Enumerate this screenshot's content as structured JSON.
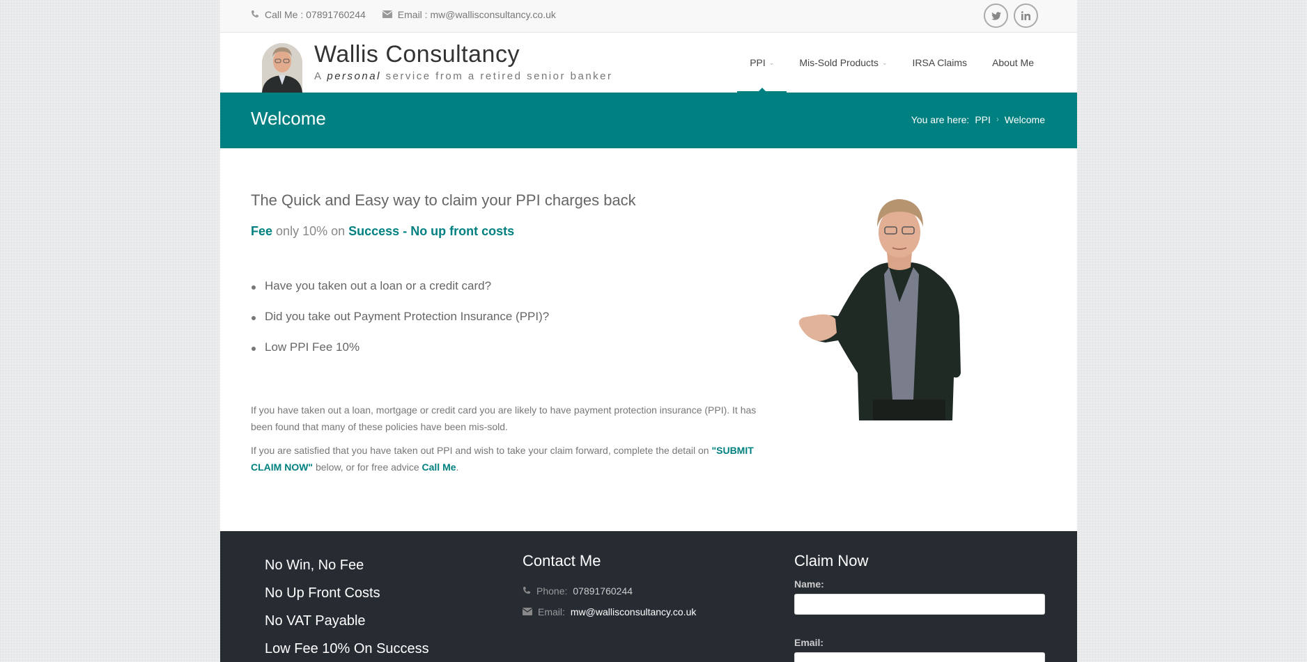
{
  "topbar": {
    "phone": "Call Me : 07891760244",
    "email": "Email : mw@wallisconsultancy.co.uk",
    "social": [
      "twitter-icon",
      "linkedin-icon"
    ]
  },
  "header": {
    "title": "Wallis Consultancy",
    "tagline_a": "A",
    "tagline_em": "personal",
    "tagline_rest": "service from a retired senior banker"
  },
  "nav": {
    "items": [
      {
        "label": "PPI",
        "dropdown": true,
        "active": true
      },
      {
        "label": "Mis-Sold Products",
        "dropdown": true
      },
      {
        "label": "IRSA Claims"
      },
      {
        "label": "About Me"
      }
    ]
  },
  "titlebar": {
    "title": "Welcome",
    "crumb_prefix": "You are here:",
    "crumb_parent": "PPI",
    "crumb_current": "Welcome"
  },
  "main": {
    "headline": "The Quick and Easy way to claim your PPI charges back",
    "fee_word": "Fee",
    "fee_mid": "only 10% on",
    "fee_success": "Success - No up front costs",
    "bullets": [
      "Have you taken out a loan or a credit card?",
      "Did you take out Payment Protection Insurance (PPI)?",
      "Low PPI Fee 10%"
    ],
    "para1": "If you have taken out a loan, mortgage or credit card you are likely to have payment protection insurance (PPI). It has been found that many of these policies have been mis-sold.",
    "para2_a": "If you are satisfied that you have taken out PPI and wish to take your claim forward, complete the detail on",
    "para2_submit": "\"SUBMIT CLAIM NOW\"",
    "para2_b": "below, or for free advice",
    "para2_call": "Call Me",
    "para2_end": "."
  },
  "footer": {
    "features": [
      "No Win, No Fee",
      "No Up Front Costs",
      "No VAT Payable",
      "Low Fee 10% On Success"
    ],
    "contact_title": "Contact Me",
    "phone_label": "Phone:",
    "phone_value": "07891760244",
    "email_label": "Email:",
    "email_value": "mw@wallisconsultancy.co.uk",
    "claim_title": "Claim Now",
    "name_label": "Name:",
    "email_field_label": "Email:"
  },
  "colors": {
    "accent": "#008080",
    "footer_bg": "#272c33"
  }
}
